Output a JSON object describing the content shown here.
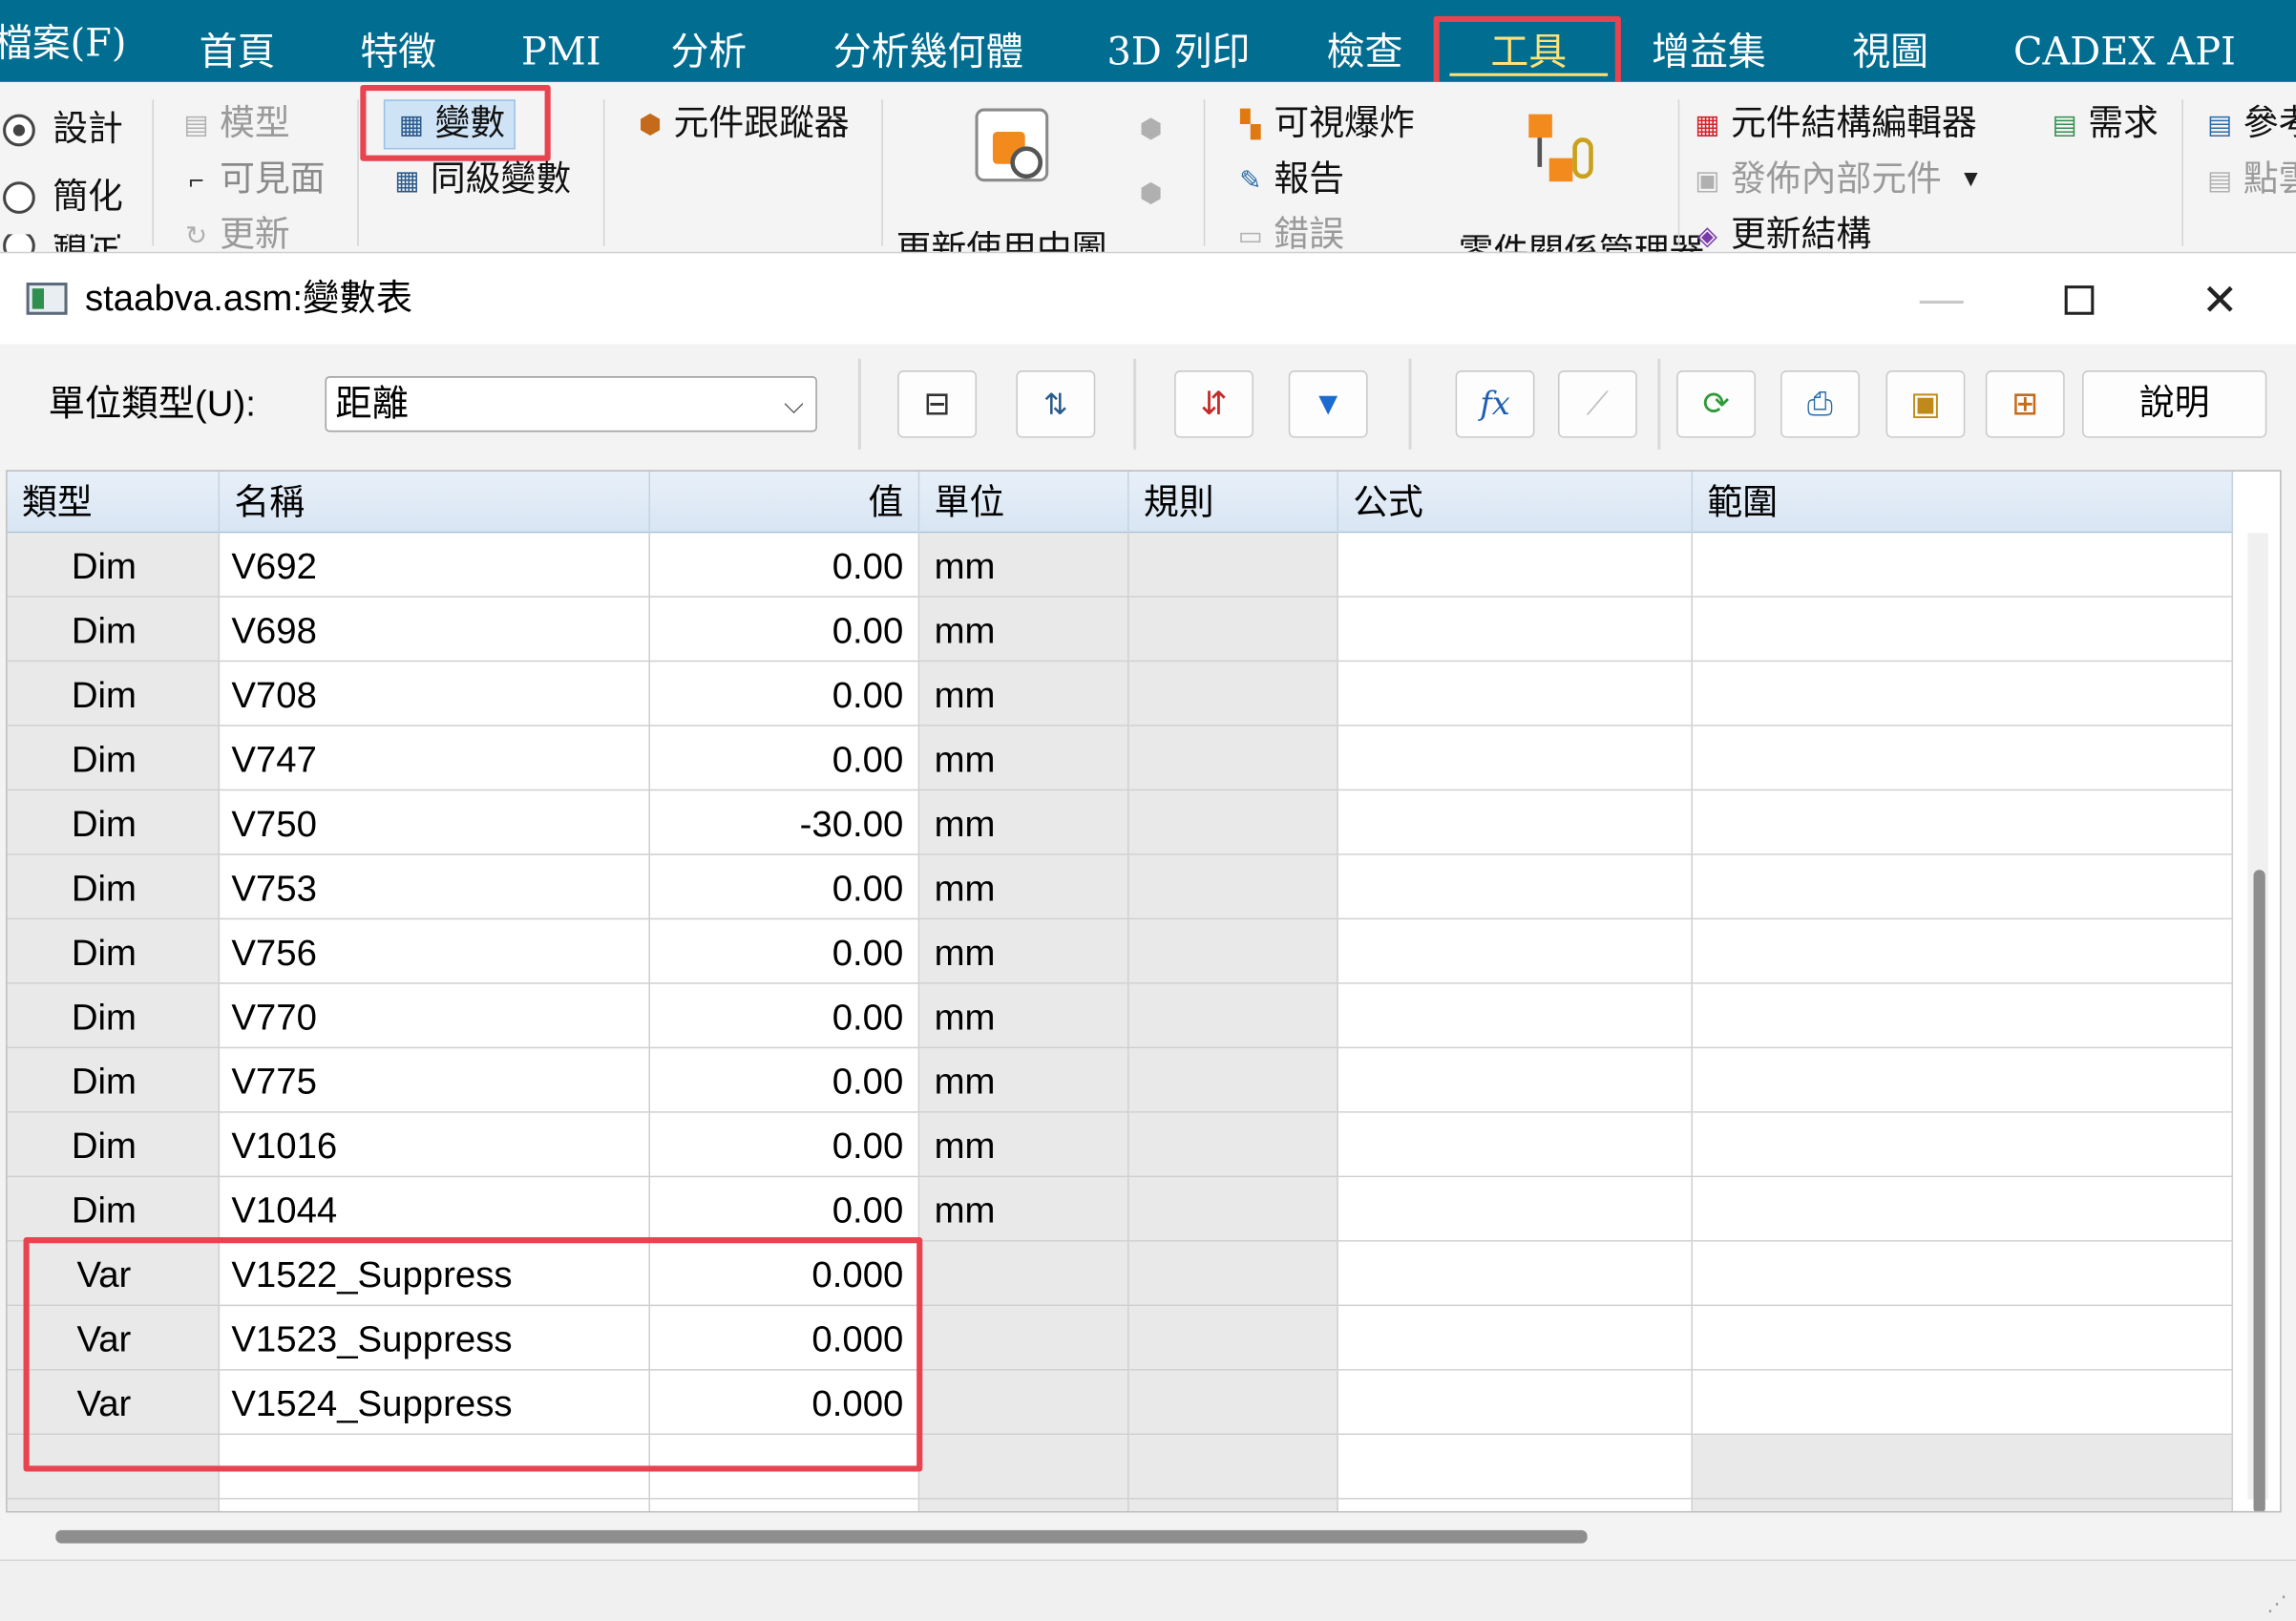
{
  "menu": {
    "items": [
      "檔案(F)",
      "首頁",
      "特徵",
      "PMI",
      "分析",
      "分析幾何體",
      "3D 列印",
      "檢查",
      "工具",
      "增益集",
      "視圖",
      "CADEX API"
    ],
    "active": "工具"
  },
  "ribbon": {
    "mode_design": "設計",
    "mode_simplify": "簡化",
    "mode_lock": "鎖定",
    "model": "模型",
    "visible_faces": "可見面",
    "update": "更新",
    "variables": "變數",
    "sibling_variables": "同級變數",
    "component_tracker": "元件跟蹤器",
    "update_in_use": "更新使用中圖",
    "visual_explode": "可視爆炸",
    "report": "報告",
    "errors": "錯誤",
    "part_relation_manager": "零件關係管理器",
    "component_structure_editor": "元件結構編輯器",
    "publish_internal_components": "發佈內部元件",
    "update_structure": "更新結構",
    "requirements": "需求",
    "reference": "參考",
    "point_cloud": "點雲"
  },
  "dialog": {
    "title": "staabva.asm:變數表",
    "unit_type_label": "單位類型(U):",
    "unit_type_value": "距離",
    "help_label": "說明"
  },
  "table": {
    "headers": [
      "類型",
      "名稱",
      "值",
      "單位",
      "規則",
      "公式",
      "範圍"
    ],
    "rows": [
      {
        "type": "Dim",
        "name": "V692",
        "value": "0.00",
        "unit": "mm"
      },
      {
        "type": "Dim",
        "name": "V698",
        "value": "0.00",
        "unit": "mm"
      },
      {
        "type": "Dim",
        "name": "V708",
        "value": "0.00",
        "unit": "mm"
      },
      {
        "type": "Dim",
        "name": "V747",
        "value": "0.00",
        "unit": "mm"
      },
      {
        "type": "Dim",
        "name": "V750",
        "value": "-30.00",
        "unit": "mm"
      },
      {
        "type": "Dim",
        "name": "V753",
        "value": "0.00",
        "unit": "mm"
      },
      {
        "type": "Dim",
        "name": "V756",
        "value": "0.00",
        "unit": "mm"
      },
      {
        "type": "Dim",
        "name": "V770",
        "value": "0.00",
        "unit": "mm"
      },
      {
        "type": "Dim",
        "name": "V775",
        "value": "0.00",
        "unit": "mm"
      },
      {
        "type": "Dim",
        "name": "V1016",
        "value": "0.00",
        "unit": "mm"
      },
      {
        "type": "Dim",
        "name": "V1044",
        "value": "0.00",
        "unit": "mm"
      },
      {
        "type": "Var",
        "name": "V1522_Suppress",
        "value": "0.000",
        "unit": ""
      },
      {
        "type": "Var",
        "name": "V1523_Suppress",
        "value": "0.000",
        "unit": ""
      },
      {
        "type": "Var",
        "name": "V1524_Suppress",
        "value": "0.000",
        "unit": ""
      }
    ]
  },
  "colors": {
    "menubar": "#006d91",
    "highlight": "#e8434f",
    "active_tab_text": "#ffe27a"
  }
}
